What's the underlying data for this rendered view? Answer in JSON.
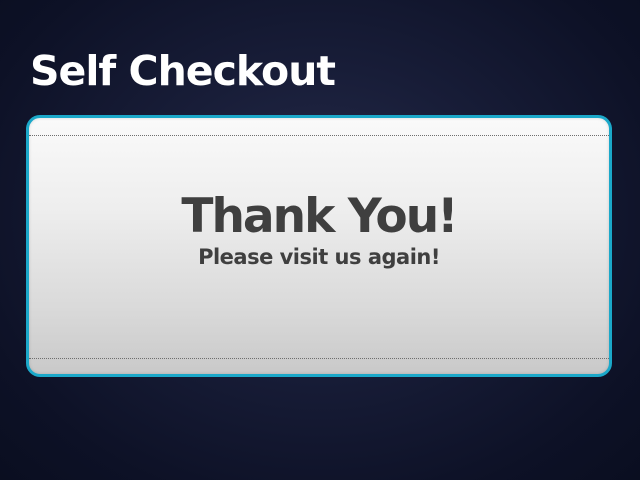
{
  "header": {
    "title": "Self Checkout"
  },
  "panel": {
    "heading": "Thank You!",
    "message": "Please visit us again!"
  },
  "colors": {
    "background": "#0d1126",
    "panel_border": "#1ba8c9",
    "panel_text": "#3f3f3f",
    "title_text": "#ffffff"
  }
}
